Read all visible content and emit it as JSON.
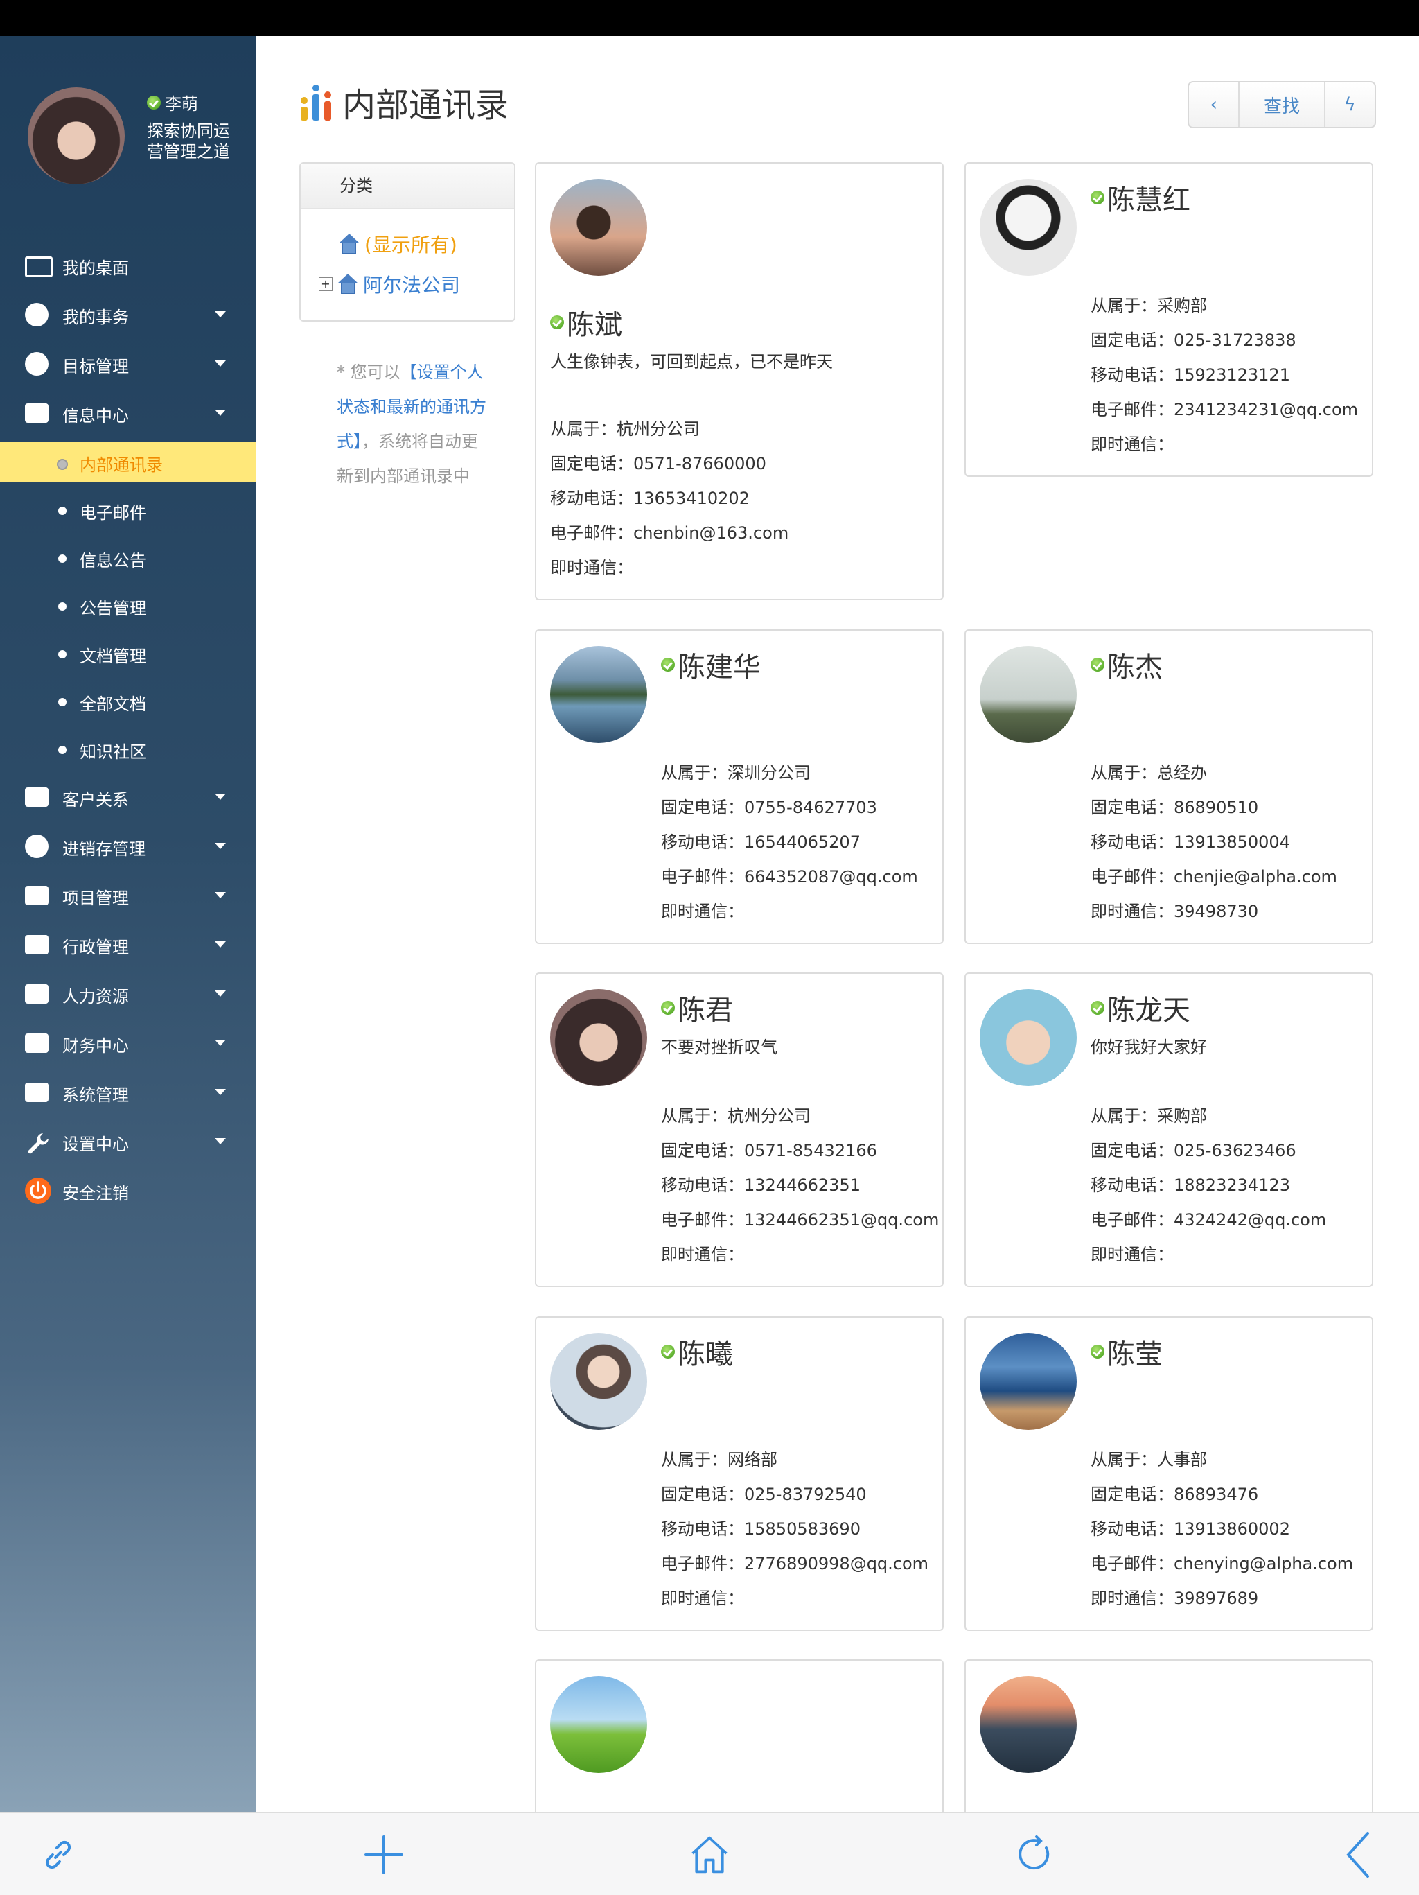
{
  "user": {
    "name": "李萌",
    "org": "探索协同运营管理之道"
  },
  "nav": [
    {
      "label": "我的桌面",
      "icon": "monitor-icon",
      "caret": false
    },
    {
      "label": "我的事务",
      "icon": "gear-icon",
      "caret": true
    },
    {
      "label": "目标管理",
      "icon": "target-icon",
      "caret": true
    },
    {
      "label": "信息中心",
      "icon": "info-icon",
      "caret": true
    },
    {
      "label": "内部通讯录",
      "sub": true,
      "active": true
    },
    {
      "label": "电子邮件",
      "sub": true
    },
    {
      "label": "信息公告",
      "sub": true
    },
    {
      "label": "公告管理",
      "sub": true
    },
    {
      "label": "文档管理",
      "sub": true
    },
    {
      "label": "全部文档",
      "sub": true
    },
    {
      "label": "知识社区",
      "sub": true
    },
    {
      "label": "客户关系",
      "icon": "contact-card-icon",
      "caret": true
    },
    {
      "label": "进销存管理",
      "icon": "disc-icon",
      "caret": true
    },
    {
      "label": "项目管理",
      "icon": "folder-icon",
      "caret": true
    },
    {
      "label": "行政管理",
      "icon": "projector-icon",
      "caret": true
    },
    {
      "label": "人力资源",
      "icon": "people-icon",
      "caret": true
    },
    {
      "label": "财务中心",
      "icon": "calculator-icon",
      "caret": true
    },
    {
      "label": "系统管理",
      "icon": "system-icon",
      "caret": true
    },
    {
      "label": "设置中心",
      "icon": "wrench-icon",
      "caret": true
    },
    {
      "label": "安全注销",
      "icon": "power-icon",
      "caret": false
    }
  ],
  "page": {
    "title": "内部通讯录"
  },
  "toolbar": {
    "back": "‹",
    "search": "查找",
    "flash": "ϟ"
  },
  "category": {
    "header": "分类",
    "show_all": "(显示所有)",
    "company": "阿尔法公司"
  },
  "hint": {
    "prefix": "* 您可以",
    "link": "【设置个人状态和最新的通讯方式】",
    "suffix": "，系统将自动更新到内部通讯录中"
  },
  "labels": {
    "dept": "从属于：",
    "tel": "固定电话：",
    "mobile": "移动电话：",
    "email": "电子邮件：",
    "im": "即时通信："
  },
  "contacts": [
    {
      "name": "陈斌",
      "sig": "人生像钟表，可回到起点，已不是昨天",
      "dept": "杭州分公司",
      "tel": "0571-87660000",
      "mobile": "13653410202",
      "email": "chenbin@163.com",
      "im": ""
    },
    {
      "name": "陈慧红",
      "sig": "",
      "dept": "采购部",
      "tel": "025-31723838",
      "mobile": "15923123121",
      "email": "2341234231@qq.com",
      "im": ""
    },
    {
      "name": "陈建华",
      "sig": "",
      "dept": "深圳分公司",
      "tel": "0755-84627703",
      "mobile": "16544065207",
      "email": "664352087@qq.com",
      "im": ""
    },
    {
      "name": "陈杰",
      "sig": "",
      "dept": "总经办",
      "tel": "86890510",
      "mobile": "13913850004",
      "email": "chenjie@alpha.com",
      "im": "39498730"
    },
    {
      "name": "陈君",
      "sig": "不要对挫折叹气",
      "dept": "杭州分公司",
      "tel": "0571-85432166",
      "mobile": "13244662351",
      "email": "13244662351@qq.com",
      "im": ""
    },
    {
      "name": "陈龙天",
      "sig": "你好我好大家好",
      "dept": "采购部",
      "tel": "025-63623466",
      "mobile": "18823234123",
      "email": "4324242@qq.com",
      "im": ""
    },
    {
      "name": "陈曦",
      "sig": "",
      "dept": "网络部",
      "tel": "025-83792540",
      "mobile": "15850583690",
      "email": "2776890998@qq.com",
      "im": ""
    },
    {
      "name": "陈莹",
      "sig": "",
      "dept": "人事部",
      "tel": "86893476",
      "mobile": "13913860002",
      "email": "chenying@alpha.com",
      "im": "39897689"
    }
  ],
  "bottombar": [
    "link-icon",
    "plus-icon",
    "home-icon",
    "refresh-icon",
    "back-chevron-icon"
  ],
  "colors": {
    "accent": "#3a7fd0",
    "active_bg": "#ffe87a",
    "active_text": "#f08a00",
    "online": "#4aa81f"
  }
}
